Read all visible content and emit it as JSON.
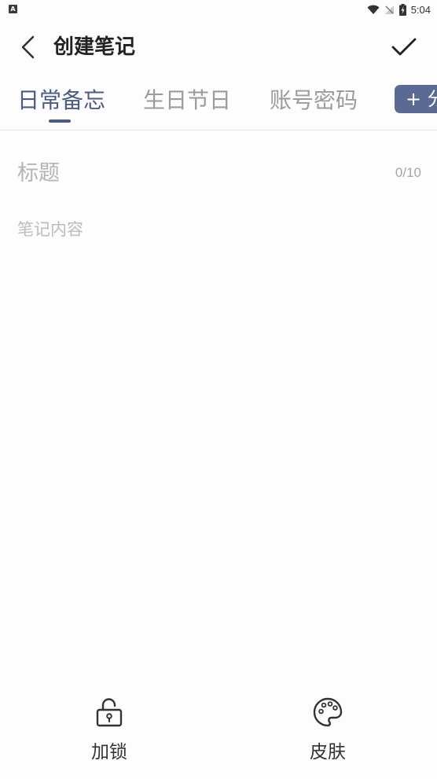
{
  "status_bar": {
    "time": "5:04",
    "notification_icon": "a-badge-icon"
  },
  "header": {
    "title": "创建笔记",
    "back_icon": "chevron-left-icon",
    "confirm_icon": "check-icon"
  },
  "tabs": [
    {
      "label": "日常备忘",
      "active": true
    },
    {
      "label": "生日节日",
      "active": false
    },
    {
      "label": "账号密码",
      "active": false
    }
  ],
  "add_category_label": "+ 分类",
  "form": {
    "title_placeholder": "标题",
    "title_counter": "0/10",
    "content_placeholder": "笔记内容"
  },
  "toolbar": {
    "lock_label": "加锁",
    "skin_label": "皮肤"
  },
  "colors": {
    "accent": "#4a5b86",
    "add_button_bg": "#5b6a92"
  }
}
